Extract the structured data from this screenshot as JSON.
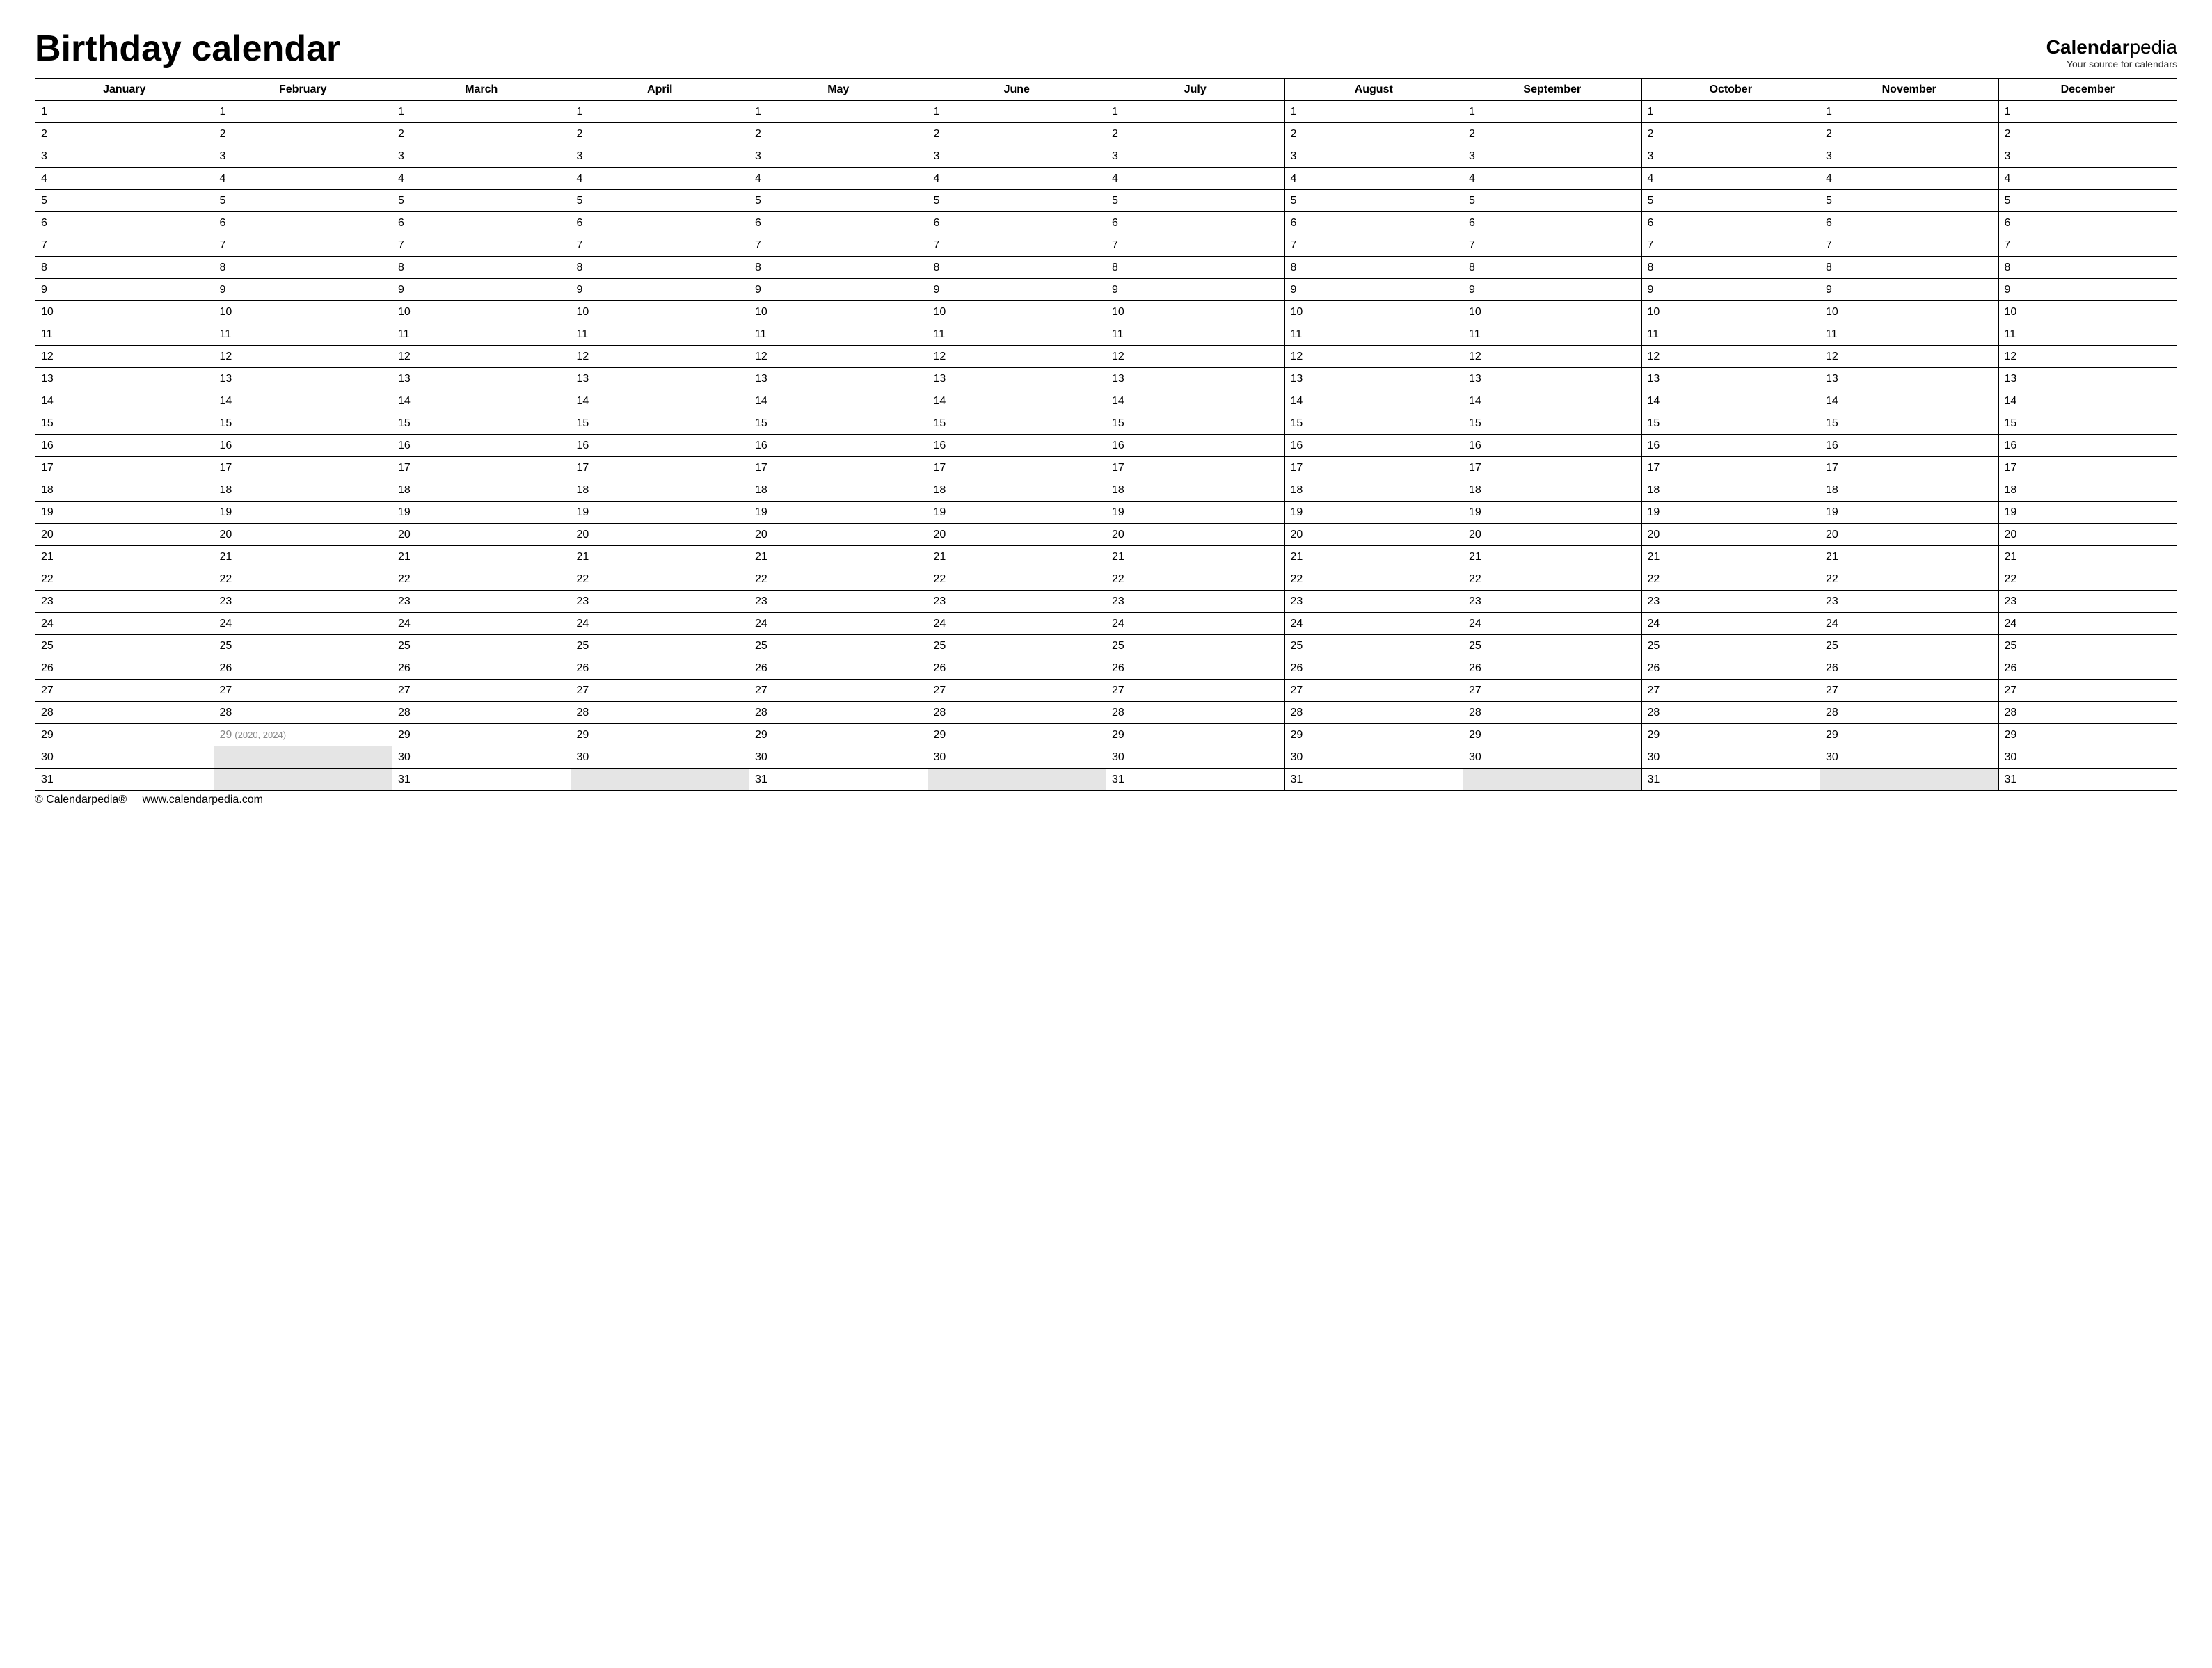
{
  "header": {
    "title": "Birthday calendar",
    "brand_prefix": "Calendar",
    "brand_suffix": "pedia",
    "brand_tagline": "Your source for calendars"
  },
  "months": [
    {
      "name": "January",
      "days": 31,
      "leap_note": ""
    },
    {
      "name": "February",
      "days": 29,
      "leap_note": "(2020, 2024)"
    },
    {
      "name": "March",
      "days": 31,
      "leap_note": ""
    },
    {
      "name": "April",
      "days": 30,
      "leap_note": ""
    },
    {
      "name": "May",
      "days": 31,
      "leap_note": ""
    },
    {
      "name": "June",
      "days": 30,
      "leap_note": ""
    },
    {
      "name": "July",
      "days": 31,
      "leap_note": ""
    },
    {
      "name": "August",
      "days": 31,
      "leap_note": ""
    },
    {
      "name": "September",
      "days": 30,
      "leap_note": ""
    },
    {
      "name": "October",
      "days": 31,
      "leap_note": ""
    },
    {
      "name": "November",
      "days": 30,
      "leap_note": ""
    },
    {
      "name": "December",
      "days": 31,
      "leap_note": ""
    }
  ],
  "max_rows": 31,
  "leap_day": 29,
  "footer": {
    "copyright": "© Calendarpedia®",
    "url": "www.calendarpedia.com"
  }
}
